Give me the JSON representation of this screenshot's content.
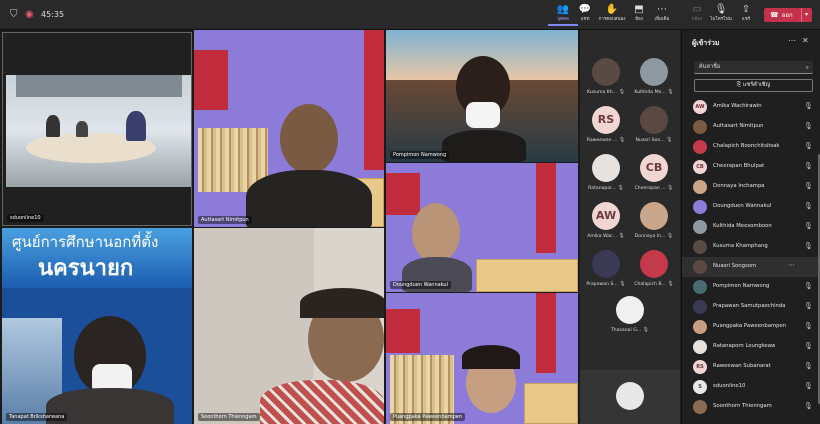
{
  "topbar": {
    "timer": "45:35",
    "buttons": [
      {
        "glyph": "👥",
        "label": "บุคคล",
        "state": "active"
      },
      {
        "glyph": "💬",
        "label": "แชท",
        "state": "normal"
      },
      {
        "glyph": "✋",
        "label": "การตอบสนอง",
        "state": "normal"
      },
      {
        "glyph": "⬒",
        "label": "ห้อง",
        "state": "normal"
      },
      {
        "glyph": "⋯",
        "label": "เพิ่มเติม",
        "state": "normal"
      },
      {
        "glyph": "▭",
        "label": "กล้อง",
        "state": "dim"
      },
      {
        "glyph": "🎙",
        "label": "ไมโครโฟน",
        "state": "normal"
      },
      {
        "glyph": "⇪",
        "label": "แชร์",
        "state": "normal"
      }
    ],
    "leave_label": "ออก"
  },
  "tiles": {
    "room": "sduonline10",
    "auttasart": "Auttasart Nimitpun",
    "pompimon": "Pompimon Namwong",
    "doungduen": "Doungduen Wannakul",
    "tanapat": "Tanapat Briksharwana",
    "soonthorn": "Soonthorn Thienngam",
    "puangpaka": "Puangpaka Paweenbampen",
    "banner_line1": "ศูนย์การศึกษานอกที่ตั้ง",
    "banner_line2": "นครนายก"
  },
  "gallery": [
    {
      "name": "Kusuma Kh...",
      "initials": ""
    },
    {
      "name": "Kulthida Me...",
      "initials": ""
    },
    {
      "name": "Raweewan ...",
      "initials": "RS"
    },
    {
      "name": "Nuasri Son...",
      "initials": ""
    },
    {
      "name": "Ratanapor...",
      "initials": ""
    },
    {
      "name": "Cheerapan ...",
      "initials": "CB"
    },
    {
      "name": "Amika Wac...",
      "initials": "AW"
    },
    {
      "name": "Donnaya In...",
      "initials": ""
    },
    {
      "name": "Prapawan S...",
      "initials": ""
    },
    {
      "name": "Chalapich B...",
      "initials": ""
    },
    {
      "name": "Thasanai G...",
      "initials": ""
    }
  ],
  "panel": {
    "title": "ผู้เข้าร่วม",
    "search_placeholder": "ค้นหาชื่อ",
    "share_invite": "แชร์คำเชิญ",
    "participants": [
      {
        "name": "Amika Wachirawin",
        "initials": "AW"
      },
      {
        "name": "Auttasart Nimitpun",
        "initials": ""
      },
      {
        "name": "Chalapich Boonchitsitsak",
        "initials": ""
      },
      {
        "name": "Cheerapan Bhulpat",
        "initials": "CB"
      },
      {
        "name": "Donnaya Inchampa",
        "initials": ""
      },
      {
        "name": "Doungduen Wannakul",
        "initials": ""
      },
      {
        "name": "Kulthida Meesomboon",
        "initials": ""
      },
      {
        "name": "Kusuma Khamphang",
        "initials": ""
      },
      {
        "name": "Nuasri Songsom",
        "initials": ""
      },
      {
        "name": "Pompimon Namwong",
        "initials": ""
      },
      {
        "name": "Prapawan Samutpaochinda",
        "initials": ""
      },
      {
        "name": "Puangpaka Paweenbampen",
        "initials": ""
      },
      {
        "name": "Ratanaporn Loungkeaw",
        "initials": ""
      },
      {
        "name": "Raweewan Subanarat",
        "initials": "RS"
      },
      {
        "name": "sduonline10",
        "initials": "S"
      },
      {
        "name": "Soonthorn Thienngam",
        "initials": ""
      }
    ]
  }
}
